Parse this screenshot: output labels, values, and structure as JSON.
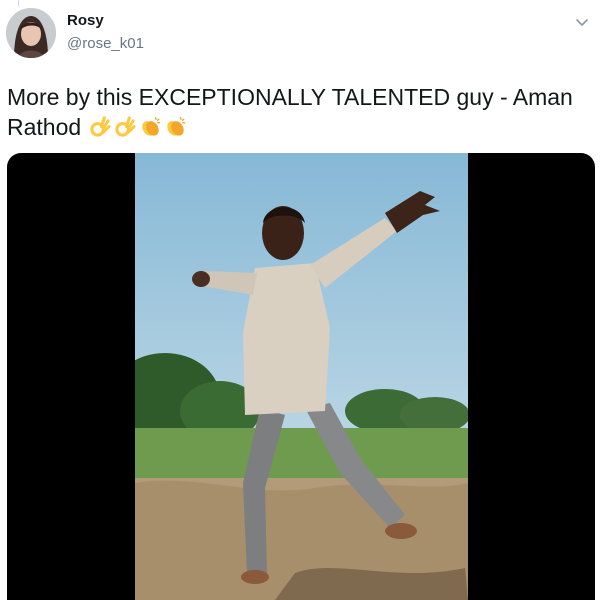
{
  "user": {
    "display_name": "Rosy",
    "handle": "@rose_k01"
  },
  "tweet": {
    "text": "More by this EXCEPTIONALLY TALENTED guy - Aman Rathod",
    "emojis": [
      "ok-hand",
      "ok-hand",
      "clapping-hands",
      "clapping-hands"
    ]
  },
  "media": {
    "type": "video",
    "subject": "man-dancing-outdoors"
  },
  "colors": {
    "text": "#14171a",
    "secondary_text": "#657786",
    "emoji_yellow": "#ffc83d"
  },
  "icons": {
    "menu": "chevron-down-icon"
  }
}
